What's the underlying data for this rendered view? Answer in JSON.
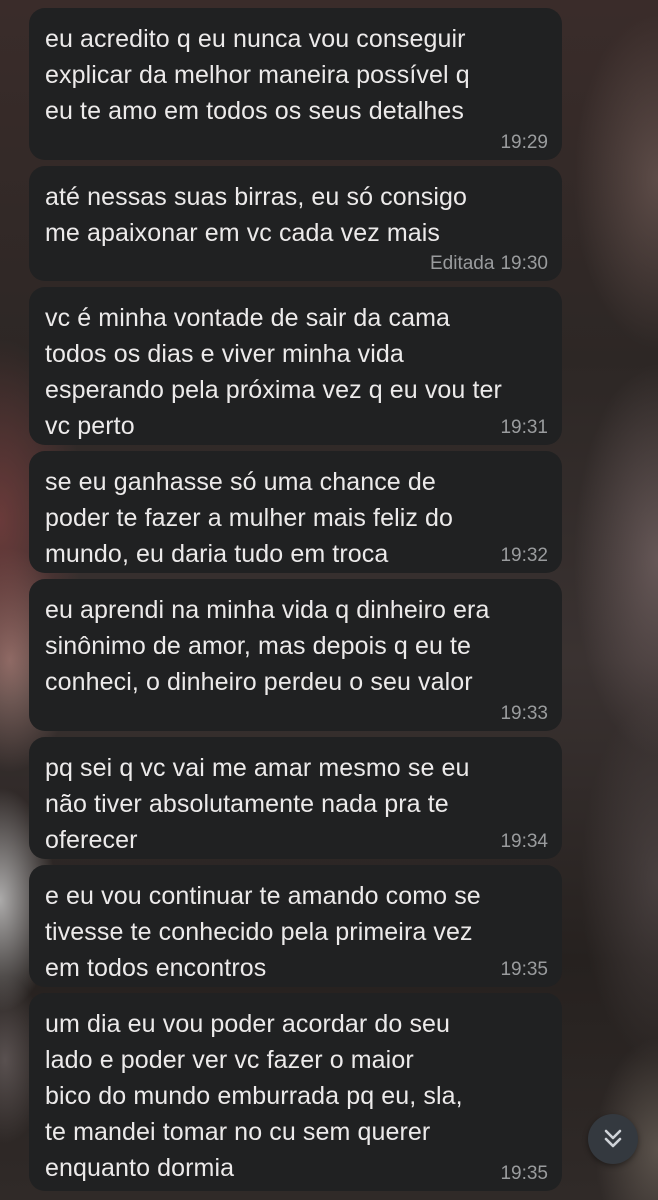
{
  "messages": [
    {
      "text": "eu acredito q eu nunca vou conseguir\nexplicar da melhor maneira possível q\neu te amo em todos os seus detalhes",
      "time": "19:29",
      "edited": ""
    },
    {
      "text": "até nessas suas birras, eu só consigo\nme apaixonar em vc cada vez mais",
      "time": "19:30",
      "edited": "Editada"
    },
    {
      "text": "vc é minha vontade de sair da cama\ntodos os dias e viver minha vida\nesperando pela próxima vez q eu vou ter\nvc perto",
      "time": "19:31",
      "edited": ""
    },
    {
      "text": "se eu ganhasse só uma chance de\npoder te fazer a mulher mais feliz do\nmundo, eu daria tudo em troca",
      "time": "19:32",
      "edited": ""
    },
    {
      "text": "eu aprendi na minha vida q dinheiro era\nsinônimo de amor, mas depois q eu te\nconheci, o dinheiro perdeu o seu valor",
      "time": "19:33",
      "edited": ""
    },
    {
      "text": "pq sei q vc vai me amar mesmo se eu\nnão tiver absolutamente nada pra te\noferecer",
      "time": "19:34",
      "edited": ""
    },
    {
      "text": "e eu vou continuar te amando como se\ntivesse te conhecido pela primeira vez\nem todos encontros",
      "time": "19:35",
      "edited": ""
    },
    {
      "text": "um dia eu vou poder acordar do seu\nlado e poder ver vc fazer o maior\nbico do mundo emburrada pq eu, sla,\nte mandei tomar no cu sem querer\nenquanto dormia",
      "time": "19:35",
      "edited": ""
    }
  ],
  "scroll_down_button": {
    "icon": "double-chevron-down-icon"
  },
  "colors": {
    "bubble": "#202122",
    "text": "#eceaea",
    "meta": "#9a9c9e"
  }
}
